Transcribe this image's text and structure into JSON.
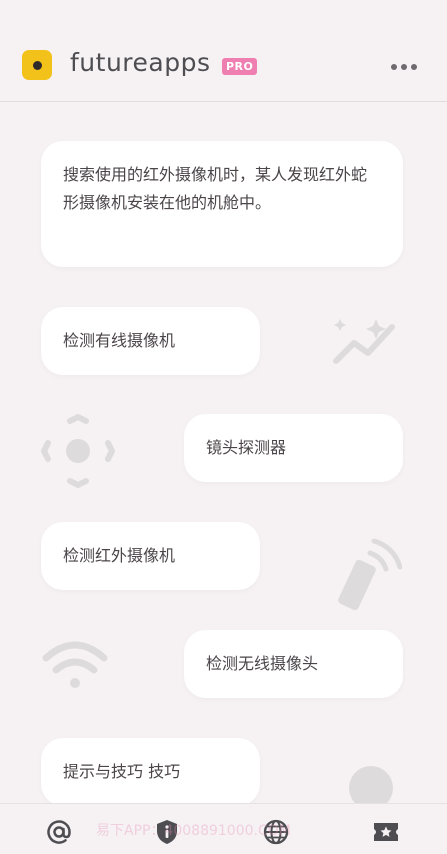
{
  "header": {
    "brand": "futureapps",
    "badge": "PRO",
    "logo_icon": "camera-lens-icon",
    "menu_icon": "more-dots-icon"
  },
  "info_card": {
    "text": "搜索使用的红外摄像机时，某人发现红外蛇形摄像机安装在他的机舱中。"
  },
  "options": [
    {
      "label": "检测有线摄像机"
    },
    {
      "label": "镜头探测器"
    },
    {
      "label": "检测红外摄像机"
    },
    {
      "label": "检测无线摄像头"
    },
    {
      "label": "提示与技巧 技巧"
    }
  ],
  "bottom_nav": [
    {
      "icon": "at-icon"
    },
    {
      "icon": "shield-info-icon"
    },
    {
      "icon": "globe-icon"
    },
    {
      "icon": "ticket-star-icon"
    }
  ],
  "watermark": "易下APP：4008891000.COM",
  "colors": {
    "background": "#f6f2f3",
    "card": "#ffffff",
    "badge": "#ef7fb1",
    "logo": "#f2c21a",
    "icon": "#4d4d52"
  }
}
